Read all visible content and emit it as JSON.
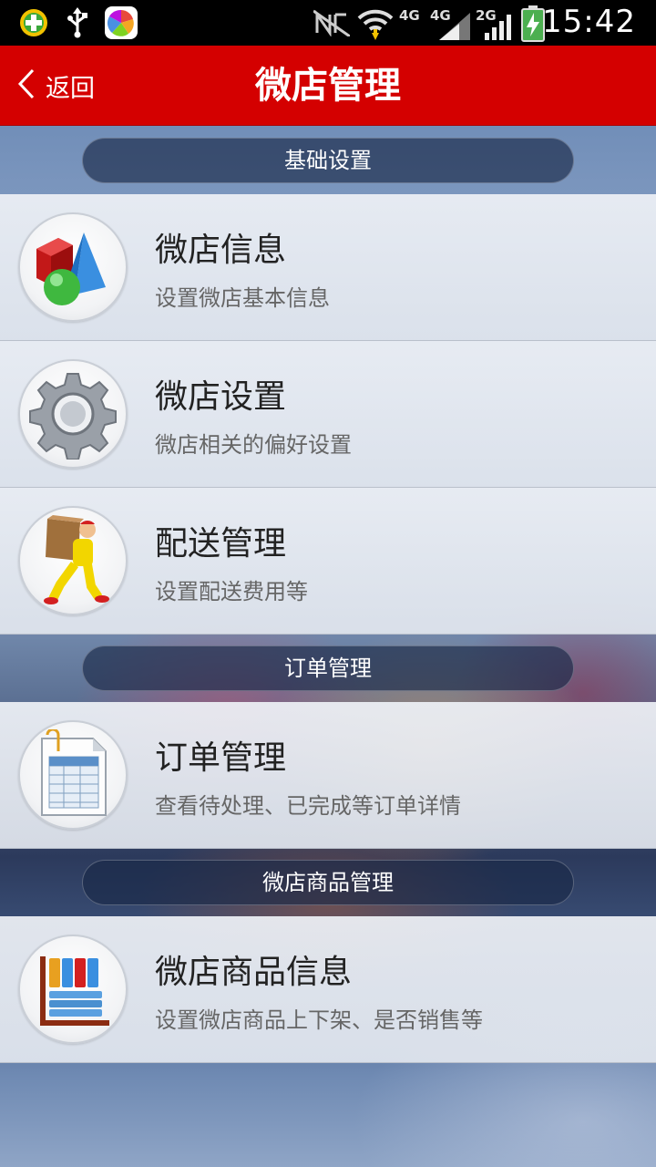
{
  "status_bar": {
    "time": "15:42",
    "net_labels": [
      "4G",
      "4G",
      "2G"
    ],
    "icons": [
      "app-360-icon",
      "usb-icon",
      "app-launcher-icon",
      "nfc-icon",
      "wifi-icon",
      "signal-icon",
      "battery-charging-icon"
    ]
  },
  "header": {
    "back_label": "返回",
    "title": "微店管理"
  },
  "sections": [
    {
      "header": "基础设置",
      "items": [
        {
          "title": "微店信息",
          "subtitle": "设置微店基本信息",
          "icon": "shapes-icon"
        },
        {
          "title": "微店设置",
          "subtitle": "微店相关的偏好设置",
          "icon": "gear-icon"
        },
        {
          "title": "配送管理",
          "subtitle": "设置配送费用等",
          "icon": "delivery-man-icon"
        }
      ]
    },
    {
      "header": "订单管理",
      "items": [
        {
          "title": "订单管理",
          "subtitle": "查看待处理、已完成等订单详情",
          "icon": "order-sheet-icon"
        }
      ]
    },
    {
      "header": "微店商品管理",
      "items": [
        {
          "title": "微店商品信息",
          "subtitle": "设置微店商品上下架、是否销售等",
          "icon": "product-shelf-icon"
        }
      ]
    }
  ],
  "colors": {
    "header_red": "#d40000",
    "status_bar": "#000000"
  }
}
